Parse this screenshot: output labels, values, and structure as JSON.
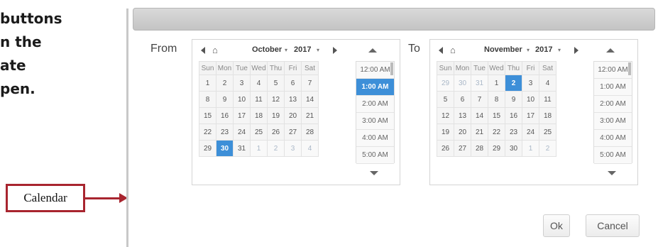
{
  "doc_text": {
    "lines": [
      "buttons",
      "n the",
      "ate",
      "pen."
    ]
  },
  "callout": {
    "label": "Calendar"
  },
  "dialog": {
    "from": {
      "label": "From",
      "month": "October",
      "year": "2017",
      "weekdays": [
        "Sun",
        "Mon",
        "Tue",
        "Wed",
        "Thu",
        "Fri",
        "Sat"
      ],
      "weeks": [
        [
          {
            "d": "1"
          },
          {
            "d": "2"
          },
          {
            "d": "3"
          },
          {
            "d": "4"
          },
          {
            "d": "5"
          },
          {
            "d": "6"
          },
          {
            "d": "7"
          }
        ],
        [
          {
            "d": "8"
          },
          {
            "d": "9"
          },
          {
            "d": "10"
          },
          {
            "d": "11"
          },
          {
            "d": "12"
          },
          {
            "d": "13"
          },
          {
            "d": "14"
          }
        ],
        [
          {
            "d": "15"
          },
          {
            "d": "16"
          },
          {
            "d": "17"
          },
          {
            "d": "18"
          },
          {
            "d": "19"
          },
          {
            "d": "20"
          },
          {
            "d": "21"
          }
        ],
        [
          {
            "d": "22"
          },
          {
            "d": "23"
          },
          {
            "d": "24"
          },
          {
            "d": "25"
          },
          {
            "d": "26"
          },
          {
            "d": "27"
          },
          {
            "d": "28"
          }
        ],
        [
          {
            "d": "29"
          },
          {
            "d": "30",
            "sel": true
          },
          {
            "d": "31"
          },
          {
            "d": "1",
            "other": true
          },
          {
            "d": "2",
            "other": true
          },
          {
            "d": "3",
            "other": true
          },
          {
            "d": "4",
            "other": true
          }
        ]
      ],
      "times": [
        "12:00 AM",
        "1:00 AM",
        "2:00 AM",
        "3:00 AM",
        "4:00 AM",
        "5:00 AM"
      ],
      "selected_time": "1:00 AM"
    },
    "to": {
      "label": "To",
      "month": "November",
      "year": "2017",
      "weekdays": [
        "Sun",
        "Mon",
        "Tue",
        "Wed",
        "Thu",
        "Fri",
        "Sat"
      ],
      "weeks": [
        [
          {
            "d": "29",
            "other": true
          },
          {
            "d": "30",
            "other": true
          },
          {
            "d": "31",
            "other": true
          },
          {
            "d": "1"
          },
          {
            "d": "2",
            "sel": true
          },
          {
            "d": "3"
          },
          {
            "d": "4"
          }
        ],
        [
          {
            "d": "5"
          },
          {
            "d": "6"
          },
          {
            "d": "7"
          },
          {
            "d": "8"
          },
          {
            "d": "9"
          },
          {
            "d": "10"
          },
          {
            "d": "11"
          }
        ],
        [
          {
            "d": "12"
          },
          {
            "d": "13"
          },
          {
            "d": "14"
          },
          {
            "d": "15"
          },
          {
            "d": "16"
          },
          {
            "d": "17"
          },
          {
            "d": "18"
          }
        ],
        [
          {
            "d": "19"
          },
          {
            "d": "20"
          },
          {
            "d": "21"
          },
          {
            "d": "22"
          },
          {
            "d": "23"
          },
          {
            "d": "24"
          },
          {
            "d": "25"
          }
        ],
        [
          {
            "d": "26"
          },
          {
            "d": "27"
          },
          {
            "d": "28"
          },
          {
            "d": "29"
          },
          {
            "d": "30"
          },
          {
            "d": "1",
            "other": true
          },
          {
            "d": "2",
            "other": true
          }
        ]
      ],
      "times": [
        "12:00 AM",
        "1:00 AM",
        "2:00 AM",
        "3:00 AM",
        "4:00 AM",
        "5:00 AM"
      ],
      "selected_time": ""
    },
    "ok_label": "Ok",
    "cancel_label": "Cancel"
  },
  "colors": {
    "accent": "#3d8fd8",
    "callout_border": "#a8252f"
  },
  "icons": {
    "prev": "triangle-left-icon",
    "home": "home-icon",
    "next": "triangle-right-icon",
    "scroll_up": "triangle-up-icon",
    "scroll_down": "triangle-down-icon"
  }
}
